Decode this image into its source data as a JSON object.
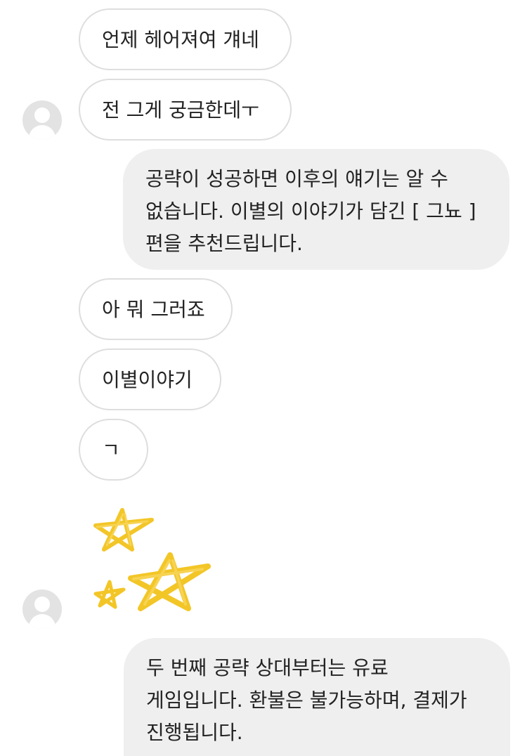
{
  "messages": [
    {
      "side": "received",
      "text": "언제 헤어져여 걔네"
    },
    {
      "side": "received",
      "text": "전 그게 궁금한데ㅜ"
    },
    {
      "side": "sent",
      "text": "공략이 성공하면 이후의 얘기는 알 수 없습니다. 이별의 이야기가 담긴 [ 그뇨 ] 편을 추천드립니다."
    },
    {
      "side": "received",
      "text": "아 뭐 그러죠"
    },
    {
      "side": "received",
      "text": "이별이야기"
    },
    {
      "side": "received",
      "text": "ㄱ"
    },
    {
      "side": "received",
      "sticker": "stars-sticker"
    },
    {
      "side": "sent",
      "text": "두 번째 공략 상대부터는 유료 게임입니다. 환불은 불가능하며, 결제가 진행됩니다."
    }
  ],
  "colors": {
    "sent_bubble": "#efefef",
    "received_border": "#dedede",
    "sticker": "#f2c31b",
    "avatar": "#e3e3e3"
  }
}
